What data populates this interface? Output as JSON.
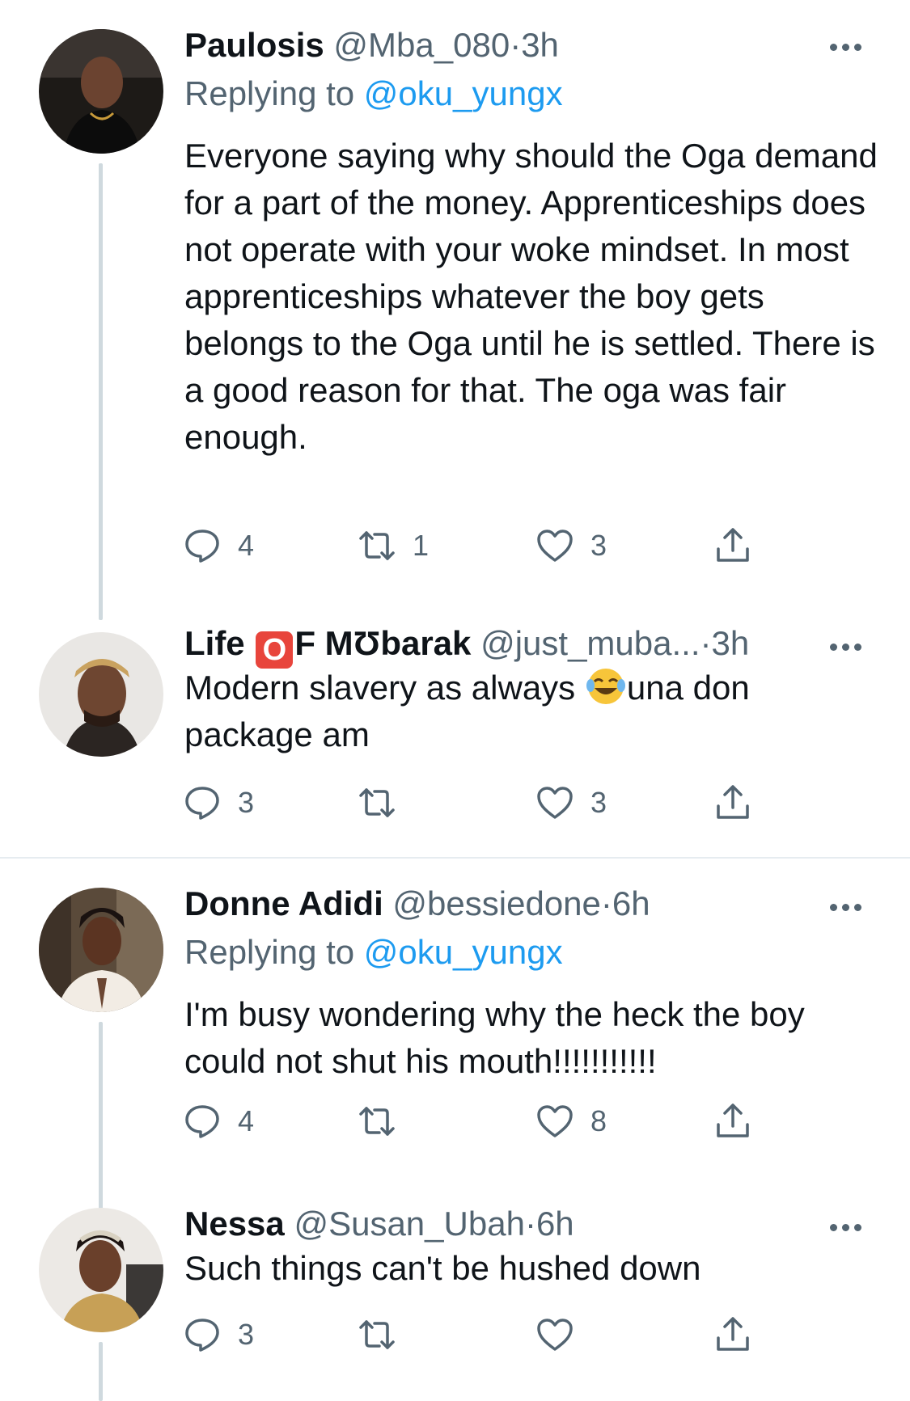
{
  "colors": {
    "text": "#0f1419",
    "muted": "#536471",
    "link": "#1d9bf0",
    "thread_line": "#cfd9de",
    "separator": "#e6ecf0",
    "emoji_o_badge": "#e8453c"
  },
  "tweets": [
    {
      "name": "Paulosis",
      "handle": "@Mba_080",
      "dot": "·",
      "time": "3h",
      "reply_prefix": "Replying to ",
      "reply_mention": "@oku_yungx",
      "text": "Everyone saying why should the Oga demand for a part of the money. Apprenticeships does not operate with your woke mindset. In most apprenticeships whatever the boy gets belongs to the Oga until he is settled. There is a good reason for that. The oga was fair enough.",
      "replies": "4",
      "retweets": "1",
      "likes": "3",
      "avatar_icon": "profile-photo-man-dark-outfit"
    },
    {
      "name_part1": "Life ",
      "name_emoji": "O",
      "name_part2": "F MƱbarak",
      "handle": "@just_muba...",
      "dot": "·",
      "time": "3h",
      "text_part1": "Modern slavery as always ",
      "text_emoji": "face-with-tears-of-joy",
      "text_part2": "una don package am",
      "replies": "3",
      "retweets": "",
      "likes": "3",
      "avatar_icon": "profile-photo-man-headwrap"
    },
    {
      "name": "Donne Adidi",
      "handle": "@bessiedone",
      "dot": "·",
      "time": "6h",
      "reply_prefix": "Replying to ",
      "reply_mention": "@oku_yungx",
      "text": "I'm busy wondering why the heck the boy could not shut his mouth!!!!!!!!!!!",
      "replies": "4",
      "retweets": "",
      "likes": "8",
      "avatar_icon": "profile-photo-woman-white-top"
    },
    {
      "name": "Nessa",
      "handle": "@Susan_Ubah",
      "dot": "·",
      "time": "6h",
      "text": "Such things can't be hushed down",
      "replies": "3",
      "retweets": "",
      "likes": "",
      "avatar_icon": "profile-photo-woman-tiara"
    }
  ]
}
